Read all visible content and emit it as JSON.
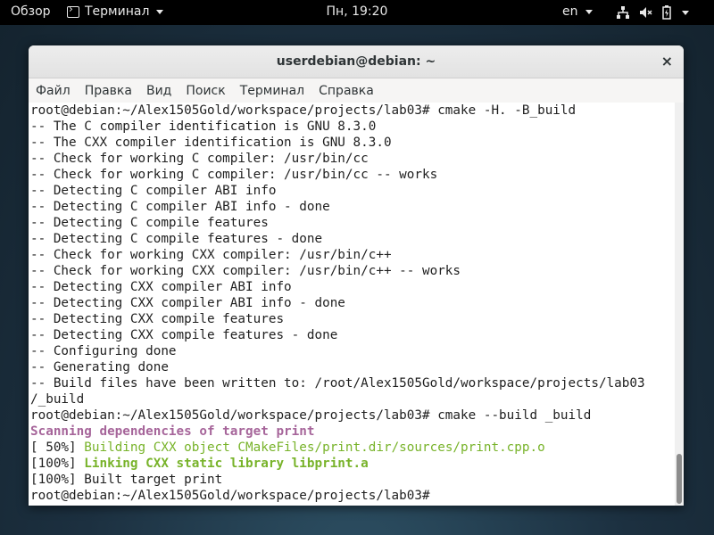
{
  "topbar": {
    "overview": "Обзор",
    "app_name": "Терминал",
    "clock": "Пн, 19:20",
    "lang": "en",
    "icons": [
      "network-icon",
      "volume-muted-icon",
      "battery-icon",
      "chevron-down-icon"
    ]
  },
  "window": {
    "title": "userdebian@debian: ~",
    "close": "×",
    "menu": [
      "Файл",
      "Правка",
      "Вид",
      "Поиск",
      "Терминал",
      "Справка"
    ]
  },
  "terminal": {
    "lines": [
      {
        "text": "root@debian:~/Alex1505Gold/workspace/projects/lab03# cmake -H. -B_build",
        "style": ""
      },
      {
        "text": "-- The C compiler identification is GNU 8.3.0",
        "style": ""
      },
      {
        "text": "-- The CXX compiler identification is GNU 8.3.0",
        "style": ""
      },
      {
        "text": "-- Check for working C compiler: /usr/bin/cc",
        "style": ""
      },
      {
        "text": "-- Check for working C compiler: /usr/bin/cc -- works",
        "style": ""
      },
      {
        "text": "-- Detecting C compiler ABI info",
        "style": ""
      },
      {
        "text": "-- Detecting C compiler ABI info - done",
        "style": ""
      },
      {
        "text": "-- Detecting C compile features",
        "style": ""
      },
      {
        "text": "-- Detecting C compile features - done",
        "style": ""
      },
      {
        "text": "-- Check for working CXX compiler: /usr/bin/c++",
        "style": ""
      },
      {
        "text": "-- Check for working CXX compiler: /usr/bin/c++ -- works",
        "style": ""
      },
      {
        "text": "-- Detecting CXX compiler ABI info",
        "style": ""
      },
      {
        "text": "-- Detecting CXX compiler ABI info - done",
        "style": ""
      },
      {
        "text": "-- Detecting CXX compile features",
        "style": ""
      },
      {
        "text": "-- Detecting CXX compile features - done",
        "style": ""
      },
      {
        "text": "-- Configuring done",
        "style": ""
      },
      {
        "text": "-- Generating done",
        "style": ""
      },
      {
        "text": "-- Build files have been written to: /root/Alex1505Gold/workspace/projects/lab03",
        "style": ""
      },
      {
        "text": "/_build",
        "style": ""
      },
      {
        "text": "root@debian:~/Alex1505Gold/workspace/projects/lab03# cmake --build _build",
        "style": ""
      },
      {
        "text": "Scanning dependencies of target print",
        "style": "purple"
      }
    ],
    "line_build_prefix": "[ 50%] ",
    "line_build_rest": "Building CXX object CMakeFiles/print.dir/sources/print.cpp.o",
    "line_link_prefix": "[100%] ",
    "line_link_rest": "Linking CXX static library libprint.a",
    "line_built": "[100%] Built target print",
    "prompt": "root@debian:~/Alex1505Gold/workspace/projects/lab03# "
  },
  "colors": {
    "purple": "#a6659a",
    "green": "#78b32a",
    "topbar": "#000000"
  }
}
